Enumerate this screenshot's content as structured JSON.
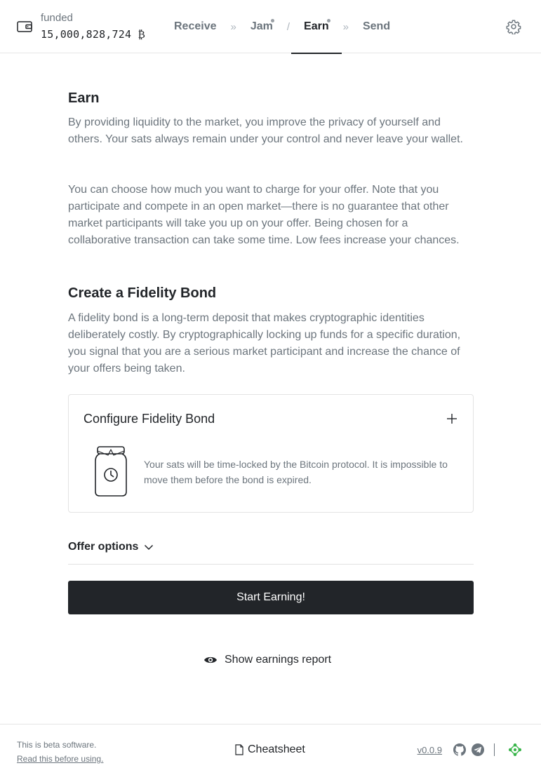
{
  "header": {
    "wallet_name": "funded",
    "wallet_balance": "15,000,828,724 ₿",
    "nav": [
      {
        "label": "Receive"
      },
      {
        "sep": "»"
      },
      {
        "label": "Jam"
      },
      {
        "sep": "/"
      },
      {
        "label": "Earn"
      },
      {
        "sep": "»"
      },
      {
        "label": "Send"
      }
    ],
    "active_tab": "Earn",
    "settings_icon": "gear-icon"
  },
  "earn": {
    "title": "Earn",
    "para1": "By providing liquidity to the market, you improve the privacy of yourself and others. Your sats always remain under your control and never leave your wallet.",
    "para2": "You can choose how much you want to charge for your offer. Note that you participate and compete in an open market—there is no guarantee that other market participants will take you up on your offer. Being chosen for a collaborative transaction can take some time. Low fees increase your chances."
  },
  "fidelity_bond": {
    "title": "Create a Fidelity Bond",
    "description": "A fidelity bond is a long-term deposit that makes cryptographic identities deliberately costly. By cryptographically locking up funds for a specific duration, you signal that you are a serious market participant and increase the chance of your offers being taken.",
    "card_title": "Configure Fidelity Bond",
    "card_description": "Your sats will be time-locked by the Bitcoin protocol. It is impossible to move them before the bond is expired."
  },
  "offer_options": {
    "label": "Offer options"
  },
  "start_button": {
    "label": "Start Earning!"
  },
  "earnings_report": {
    "label": "Show earnings report"
  },
  "footer": {
    "beta_text": "This is beta software.",
    "beta_link": "Read this before using.",
    "cheatsheet": "Cheatsheet",
    "version": "v0.0.9"
  },
  "colors": {
    "text": "#222529",
    "muted": "#6c757d",
    "border": "#e3e3e3",
    "primary_button": "#222529",
    "onion_green": "#39b54a"
  }
}
